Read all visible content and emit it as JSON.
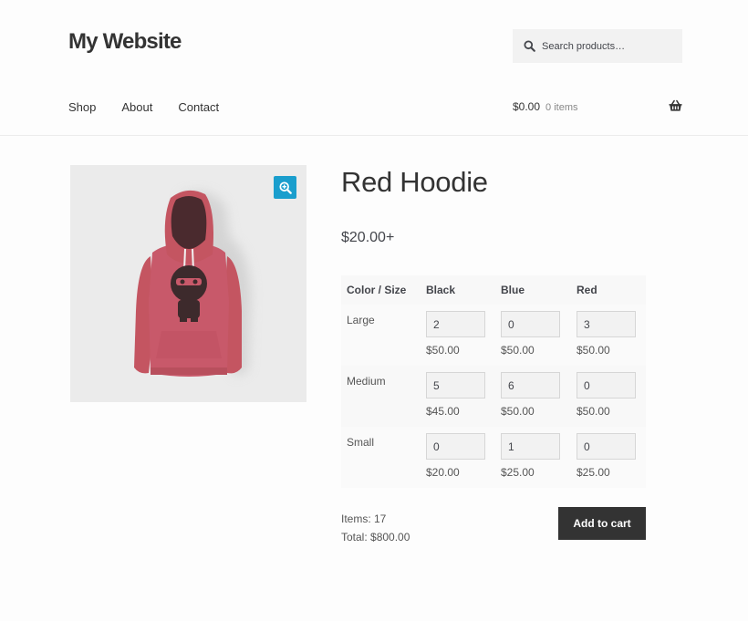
{
  "header": {
    "site_title": "My Website",
    "search": {
      "placeholder": "Search products…",
      "value": ""
    },
    "nav": [
      {
        "label": "Shop"
      },
      {
        "label": "About"
      },
      {
        "label": "Contact"
      }
    ],
    "cart": {
      "total": "$0.00",
      "count": "0 items"
    }
  },
  "product": {
    "title": "Red Hoodie",
    "price": "$20.00+",
    "image_alt": "Red hoodie with ninja graphic",
    "colors": {
      "accent": "#1a9ecd",
      "hoodie": "#c45561",
      "button": "#333333"
    },
    "grid": {
      "corner_header": "Color / Size",
      "columns": [
        "Black",
        "Blue",
        "Red"
      ],
      "rows": [
        {
          "size": "Large",
          "cells": [
            {
              "qty": "2",
              "price": "$50.00"
            },
            {
              "qty": "0",
              "price": "$50.00"
            },
            {
              "qty": "3",
              "price": "$50.00"
            }
          ]
        },
        {
          "size": "Medium",
          "cells": [
            {
              "qty": "5",
              "price": "$45.00"
            },
            {
              "qty": "6",
              "price": "$50.00"
            },
            {
              "qty": "0",
              "price": "$50.00"
            }
          ]
        },
        {
          "size": "Small",
          "cells": [
            {
              "qty": "0",
              "price": "$20.00"
            },
            {
              "qty": "1",
              "price": "$25.00"
            },
            {
              "qty": "0",
              "price": "$25.00"
            }
          ]
        }
      ]
    },
    "summary": {
      "items": "Items: 17",
      "total": "Total: $800.00"
    },
    "add_to_cart_label": "Add to cart"
  }
}
